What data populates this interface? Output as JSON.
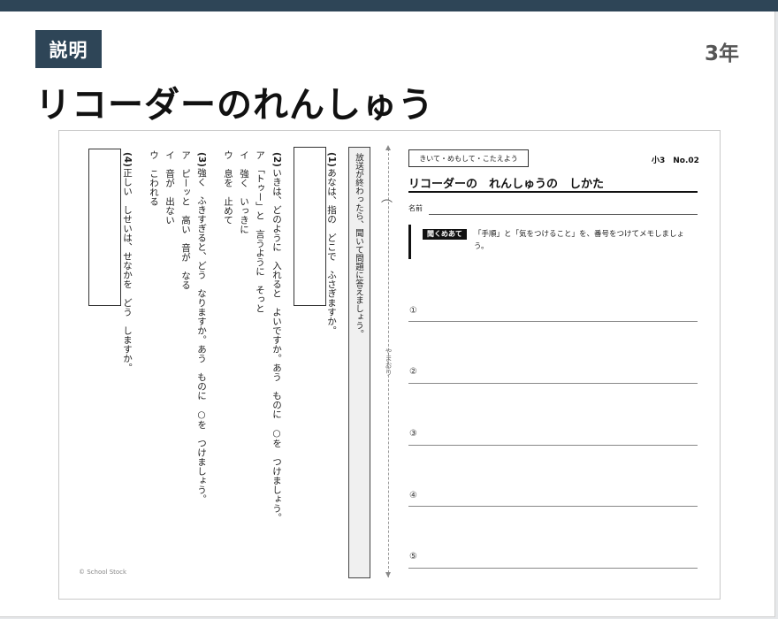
{
  "header": {
    "badge": "説明",
    "grade": "3年",
    "title": "リコーダーのれんしゅう"
  },
  "worksheet": {
    "tag": "きいて・めもして・こたえよう",
    "number": "小3　No.02",
    "title": "リコーダーの　れんしゅうの　しかた",
    "name_label": "名前",
    "instruction": "放送が終わったら、聞いて問題に答えましょう。",
    "fold_label": "やまおり",
    "copyright": "© School Stock",
    "prompt_tag": "聞くめあて",
    "prompt_text": "「手順」と「気をつけること」を、番号をつけてメモしましょう。",
    "memo_numbers": [
      "①",
      "②",
      "③",
      "④",
      "⑤"
    ],
    "questions": [
      {
        "num": "(1)",
        "lines": [
          "あなは、指の　どこで　ふさぎますか。"
        ]
      },
      {
        "num": "(2)",
        "lines": [
          "いきは、どのように　入れると　よいですか。あう　ものに　○を　つけましょう。",
          "ア　「トゥー」と　言うように　そっと",
          "イ　強く　いっきに",
          "ウ　息を　止めて"
        ]
      },
      {
        "num": "(3)",
        "lines": [
          "強く　ふきすぎると、どう　なりますか。あう　ものに　○を　つけましょう。",
          "ア　ピーッと　高い　音が　なる",
          "イ　音が　出ない",
          "ウ　こわれる"
        ]
      },
      {
        "num": "(4)",
        "lines": [
          "正しい　しせいは、せなかを　どう　しますか。"
        ]
      }
    ]
  },
  "colors": {
    "accent": "#2e4557",
    "page_bg": "#e6e8ea"
  }
}
